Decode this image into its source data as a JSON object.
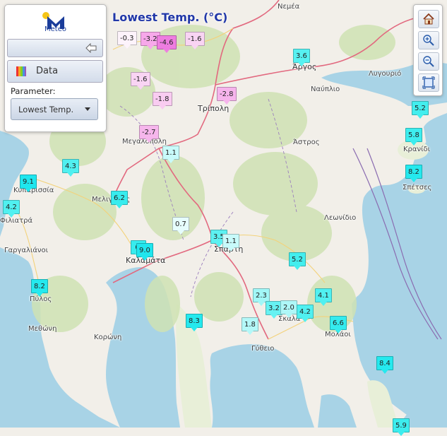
{
  "map": {
    "title": "Lowest Temp. (°C)",
    "sea_color": "#a8d3e6",
    "land_color": "#f2efe9"
  },
  "panel": {
    "logo_text": "Meteo",
    "data_button_label": "Data",
    "parameter_label": "Parameter:",
    "parameter_value": "Lowest Temp.",
    "collapse_icon": "arrow-left-icon",
    "data_icon": "color-scale-icon"
  },
  "toolbar": {
    "buttons": [
      "home-icon",
      "zoom-in-icon",
      "zoom-out-icon",
      "extent-icon"
    ]
  },
  "places": [
    {
      "name": "Νεμέα"
    },
    {
      "name": "Άργος"
    },
    {
      "name": "Λυγουριό"
    },
    {
      "name": "Ναύπλιο"
    },
    {
      "name": "Τρίπολη"
    },
    {
      "name": "Μεγαλόπολη"
    },
    {
      "name": "Άστρος"
    },
    {
      "name": "Κρανίδι"
    },
    {
      "name": "Σπέτσες"
    },
    {
      "name": "Κυπαρισσία"
    },
    {
      "name": "Φιλιατρά"
    },
    {
      "name": "Μελιγαλάς"
    },
    {
      "name": "Λεωνίδιο"
    },
    {
      "name": "Γαργαλιάνοι"
    },
    {
      "name": "Καλαμάτα"
    },
    {
      "name": "Σπάρτη"
    },
    {
      "name": "Πύλος"
    },
    {
      "name": "Σκάλα"
    },
    {
      "name": "Μολάοι"
    },
    {
      "name": "Μεθώνη"
    },
    {
      "name": "Κορώνη"
    },
    {
      "name": "Γύθειο"
    }
  ],
  "stations": [
    {
      "value": "-0.3",
      "color": "#fdf3fb"
    },
    {
      "value": "-3.2",
      "color": "#f7a8ea"
    },
    {
      "value": "-4.6",
      "color": "#ee7de0"
    },
    {
      "value": "-1.6",
      "color": "#f9d4f3"
    },
    {
      "value": "3.6",
      "color": "#56f1f1"
    },
    {
      "value": "-1.6",
      "color": "#f9d4f3"
    },
    {
      "value": "-1.8",
      "color": "#f9ccf1"
    },
    {
      "value": "-2.8",
      "color": "#f6b4ec"
    },
    {
      "value": "5.2",
      "color": "#43eeee"
    },
    {
      "value": "-2.7",
      "color": "#f6b6ec"
    },
    {
      "value": "5.8",
      "color": "#3dedee"
    },
    {
      "value": "1.1",
      "color": "#c8fafa"
    },
    {
      "value": "4.3",
      "color": "#50f0f0"
    },
    {
      "value": "8.2",
      "color": "#25e9ee"
    },
    {
      "value": "9.1",
      "color": "#1fe6ee"
    },
    {
      "value": "6.2",
      "color": "#38ecee"
    },
    {
      "value": "4.2",
      "color": "#50f0f0"
    },
    {
      "value": "0.7",
      "color": "#e6fdfd"
    },
    {
      "value": "3.5",
      "color": "#5df1f1"
    },
    {
      "value": "1.1",
      "color": "#c8fafa"
    },
    {
      "value": "6.",
      "color": "#38ecee"
    },
    {
      "value": "9.0",
      "color": "#1fe6ee"
    },
    {
      "value": "5.2",
      "color": "#43eeee"
    },
    {
      "value": "8.2",
      "color": "#25e9ee"
    },
    {
      "value": "2.3",
      "color": "#a2f7f7"
    },
    {
      "value": "4.1",
      "color": "#50f0f0"
    },
    {
      "value": "3.2",
      "color": "#66f2f2"
    },
    {
      "value": "2.0",
      "color": "#aef7f7"
    },
    {
      "value": "4.2",
      "color": "#50f0f0"
    },
    {
      "value": "8.3",
      "color": "#25e9ee"
    },
    {
      "value": "1.8",
      "color": "#b4f8f8"
    },
    {
      "value": "6.6",
      "color": "#34ebee"
    },
    {
      "value": "8.4",
      "color": "#25e9ee"
    },
    {
      "value": "5.9",
      "color": "#3dedee"
    }
  ]
}
